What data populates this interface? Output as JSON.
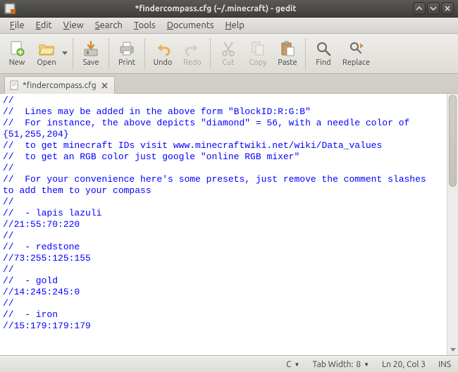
{
  "window": {
    "title": "*findercompass.cfg (~/.minecraft) - gedit"
  },
  "menu": {
    "file": "File",
    "edit": "Edit",
    "view": "View",
    "search": "Search",
    "tools": "Tools",
    "documents": "Documents",
    "help": "Help"
  },
  "toolbar": {
    "new": "New",
    "open": "Open",
    "save": "Save",
    "print": "Print",
    "undo": "Undo",
    "redo": "Redo",
    "cut": "Cut",
    "copy": "Copy",
    "paste": "Paste",
    "find": "Find",
    "replace": "Replace"
  },
  "tab": {
    "label": "*findercompass.cfg"
  },
  "editor": {
    "content": "//\n//  Lines may be added in the above form \"BlockID:R:G:B\"\n//  For instance, the above depicts \"diamond\" = 56, with a needle color of\n{51,255,204}\n//  to get minecraft IDs visit www.minecraftwiki.net/wiki/Data_values\n//  to get an RGB color just google \"online RGB mixer\"\n//\n//  For your convenience here's some presets, just remove the comment slashes\nto add them to your compass\n//\n//  - lapis lazuli\n//21:55:70:220\n//\n//  - redstone\n//73:255:125:155\n//\n//  - gold\n//14:245:245:0\n//\n//  - iron\n//15:179:179:179"
  },
  "status": {
    "lang": "C",
    "tabwidth_label": "Tab Width:",
    "tabwidth_value": "8",
    "cursor": "Ln 20, Col 3",
    "insert": "INS"
  }
}
